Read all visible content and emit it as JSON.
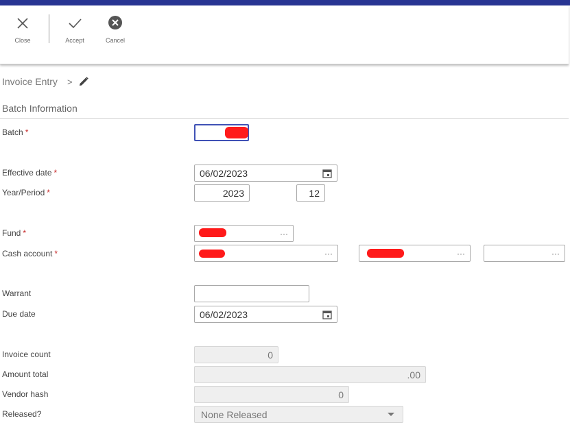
{
  "toolbar": {
    "close_label": "Close",
    "accept_label": "Accept",
    "cancel_label": "Cancel"
  },
  "breadcrumb": {
    "parent": "Invoice Entry",
    "separator": ">"
  },
  "section": {
    "title": "Batch Information"
  },
  "form": {
    "required_mark": "*",
    "batch": {
      "label": "Batch",
      "value": ""
    },
    "effective_date": {
      "label": "Effective date",
      "value": "06/02/2023"
    },
    "year_period": {
      "label": "Year/Period",
      "year": "2023",
      "period": "12"
    },
    "fund": {
      "label": "Fund",
      "value": ""
    },
    "cash_account": {
      "label": "Cash account",
      "value1": "",
      "value2": "",
      "value3": ""
    },
    "warrant": {
      "label": "Warrant",
      "value": ""
    },
    "due_date": {
      "label": "Due date",
      "value": "06/02/2023"
    },
    "invoice_count": {
      "label": "Invoice count",
      "value": "0"
    },
    "amount_total": {
      "label": "Amount total",
      "value": ".00"
    },
    "vendor_hash": {
      "label": "Vendor hash",
      "value": "0"
    },
    "released": {
      "label": "Released?",
      "value": "None Released"
    }
  },
  "icons": {
    "ellipsis": "···"
  },
  "colors": {
    "header_bar": "#283593",
    "focus_border": "#3f51b5",
    "required": "#c62828",
    "redaction": "#ff1a1a"
  }
}
